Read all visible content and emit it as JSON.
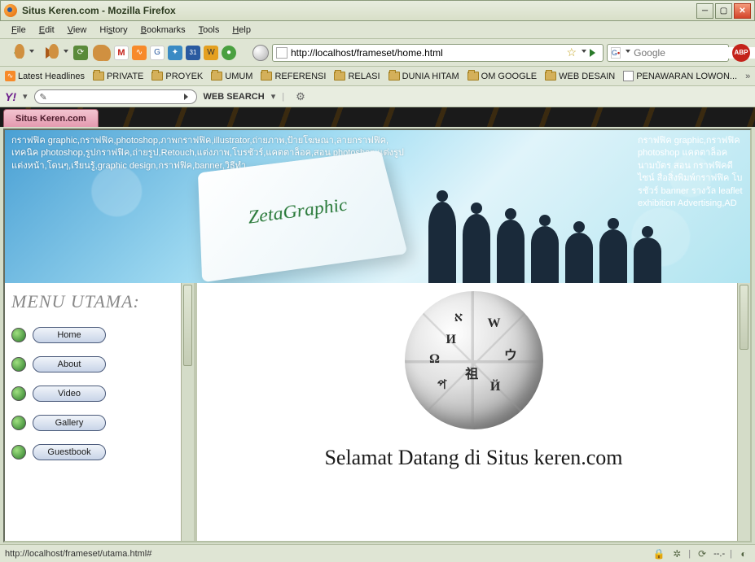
{
  "window": {
    "title": "Situs Keren.com - Mozilla Firefox"
  },
  "menubar": [
    "File",
    "Edit",
    "View",
    "History",
    "Bookmarks",
    "Tools",
    "Help"
  ],
  "url": "http://localhost/frameset/home.html",
  "search_placeholder": "Google",
  "abp_label": "ABP",
  "bookmarks": [
    {
      "icon": "rss",
      "label": "Latest Headlines"
    },
    {
      "icon": "folder",
      "label": "PRIVATE"
    },
    {
      "icon": "folder",
      "label": "PROYEK"
    },
    {
      "icon": "folder",
      "label": "UMUM"
    },
    {
      "icon": "folder",
      "label": "REFERENSI"
    },
    {
      "icon": "folder",
      "label": "RELASI"
    },
    {
      "icon": "folder",
      "label": "DUNIA HITAM"
    },
    {
      "icon": "folder",
      "label": "OM GOOGLE"
    },
    {
      "icon": "folder",
      "label": "WEB DESAIN"
    },
    {
      "icon": "page",
      "label": "PENAWARAN LOWON..."
    }
  ],
  "yahoo": {
    "logo": "Y!",
    "web_search_label": "WEB SEARCH"
  },
  "tab_label": "Situs Keren.com",
  "banner": {
    "logo_text": "ZetaGraphic",
    "tags_line1": "กราฟฟิค graphic,กราฟฟิค,photoshop,ภาพกราฟฟิค,illustrator,ถ่ายภาพ,ป้ายโฆษณา,ลายกราฟฟิค,",
    "tags_line2": "เทคนิค photoshop,รูปกราฟฟิค,ถ่ายรูป,Retouch,แต่งภาพ,โบรชัวร์,แคตตาล็อค,สอน photoshop,แต่งรูป",
    "tags_line3": "แต่งหน้า,โดนๆ,เรียนรู้,graphic design,กราฟฟิค,banner,วิธีทำ",
    "tags_r": "กราฟฟิค graphic,กราฟฟิค photoshop แคตตาล็อค นามบัตร สอน กราฟฟิคดีไซน์ สื่อสิ่งพิมพ์กราฟฟิค โบรชัวร์ banner รางวัล leaflet exhibition Advertising,AD"
  },
  "sidebar": {
    "title": "MENU UTAMA:",
    "items": [
      "Home",
      "About",
      "Video",
      "Gallery",
      "Guestbook"
    ]
  },
  "main": {
    "welcome": "Selamat Datang di Situs keren.com",
    "globe_chars": [
      "W",
      "И",
      "祖",
      "Ω",
      "ウ",
      "א",
      "Й",
      "প"
    ]
  },
  "statusbar": {
    "url": "http://localhost/frameset/utama.html#",
    "proxy": "--.-"
  }
}
